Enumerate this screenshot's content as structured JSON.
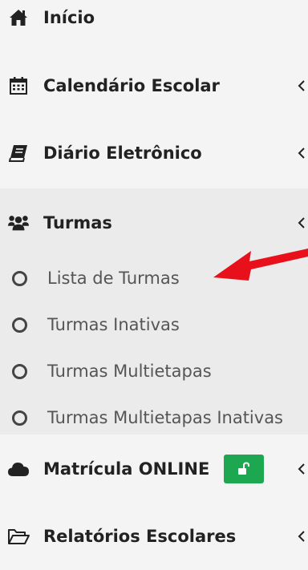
{
  "menu": {
    "inicio": {
      "label": "Início",
      "icon": "home-icon"
    },
    "calendario": {
      "label": "Calendário Escolar",
      "icon": "calendar-icon"
    },
    "diario": {
      "label": "Diário Eletrônico",
      "icon": "book-icon"
    },
    "turmas": {
      "label": "Turmas",
      "icon": "users-icon",
      "subitems": [
        {
          "label": "Lista de Turmas"
        },
        {
          "label": "Turmas Inativas"
        },
        {
          "label": "Turmas Multietapas"
        },
        {
          "label": "Turmas Multietapas Inativas"
        }
      ]
    },
    "matricula": {
      "label": "Matrícula ONLINE",
      "icon": "cloud-icon",
      "badge_icon": "unlock-icon",
      "badge_color": "#1da750"
    },
    "relatorios": {
      "label": "Relatórios Escolares",
      "icon": "folder-open-icon"
    }
  },
  "annotation": {
    "arrow_color": "#e8101b"
  }
}
